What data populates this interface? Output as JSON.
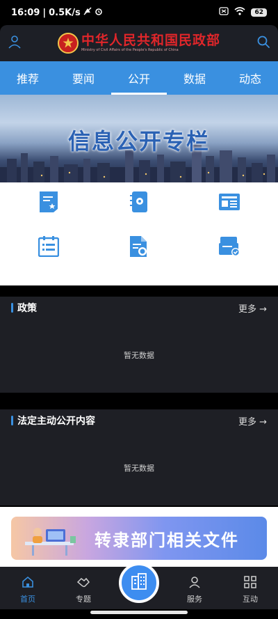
{
  "status_bar": {
    "time": "16:09",
    "speed": "0.5K/s",
    "battery": "62"
  },
  "header": {
    "title_cn": "中华人民共和国民政部",
    "title_en": "Ministry of Civil Affairs of the People's Republic of China"
  },
  "tabs": [
    {
      "label": "推荐",
      "active": false
    },
    {
      "label": "要闻",
      "active": false
    },
    {
      "label": "公开",
      "active": true
    },
    {
      "label": "数据",
      "active": false
    },
    {
      "label": "动态",
      "active": false
    }
  ],
  "banner": {
    "title": "信息公开专栏"
  },
  "icon_grid": {
    "icons": [
      "document-star-icon",
      "notebook-icon",
      "news-icon",
      "list-icon",
      "document-search-icon",
      "inbox-check-icon"
    ],
    "color": "#3a90e0"
  },
  "sections": [
    {
      "title": "政策",
      "more": "更多",
      "empty": "暂无数据"
    },
    {
      "title": "法定主动公开内容",
      "more": "更多",
      "empty": "暂无数据"
    }
  ],
  "promo": {
    "text": "转隶部门相关文件"
  },
  "bottom_nav": {
    "items": [
      {
        "label": "首页",
        "icon": "home-icon",
        "active": true
      },
      {
        "label": "专题",
        "icon": "handshake-icon",
        "active": false
      },
      {
        "label": "服务",
        "icon": "user-icon",
        "active": false
      },
      {
        "label": "互动",
        "icon": "grid-icon",
        "active": false
      }
    ],
    "center_icon": "building-icon"
  },
  "colors": {
    "accent": "#3a90e0",
    "header_bg": "#1d1f26",
    "title_red": "#e0262a"
  }
}
